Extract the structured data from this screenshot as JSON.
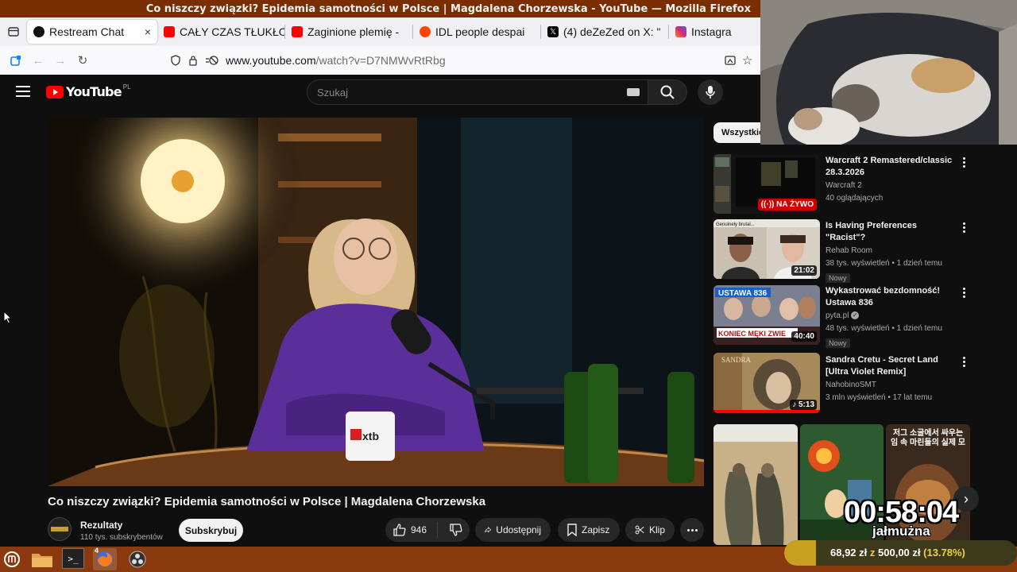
{
  "window": {
    "title": "Co niszczy związki? Epidemia samotności w Polsce | Magdalena Chorzewska - YouTube — Mozilla Firefox"
  },
  "tabs": [
    {
      "label": "Restream Chat",
      "close": "×",
      "favicon_color": "#111111",
      "icon": "restream-icon"
    },
    {
      "label": "CAŁY CZAS TŁUKŁO",
      "favicon_color": "#ff0000",
      "icon": "youtube-icon"
    },
    {
      "label": "Zaginione plemię -",
      "favicon_color": "#ff0000",
      "icon": "youtube-icon"
    },
    {
      "label": "IDL people despai",
      "favicon_color": "#ff4500",
      "icon": "reddit-icon"
    },
    {
      "label": "(4) deZeZed on X: \"",
      "favicon_color": "#000000",
      "icon": "x-icon"
    },
    {
      "label": "Instagra",
      "favicon_color": "#d62976",
      "icon": "instagram-icon"
    }
  ],
  "navbar": {
    "url_host": "www.youtube.com",
    "url_path": "/watch?v=D7NMWvRtRbg"
  },
  "youtube": {
    "logo_text": "YouTube",
    "region": "PL",
    "search_placeholder": "Szukaj",
    "brand_color": "#ff0000"
  },
  "video": {
    "title": "Co niszczy związki? Epidemia samotności w Polsce | Magdalena Chorzewska",
    "mug_text": "xtb",
    "channel": "Rezultaty",
    "subscribers": "110 tys. subskrybentów",
    "subscribe_label": "Subskrybuj",
    "likes": "946",
    "share_label": "Udostępnij",
    "save_label": "Zapisz",
    "clip_label": "Klip"
  },
  "sidebar": {
    "chip": "Wszystkie",
    "recommendations": [
      {
        "title": "Warcraft 2 Remastered/classic 28.3.2026",
        "channel": "Warcraft 2",
        "stats": "40 oglądających",
        "live_label": "NA ŻYWO"
      },
      {
        "title": "Is Having Preferences \"Racist\"?",
        "channel": "Rehab Room",
        "stats": "38 tys. wyświetleń • 1 dzień temu",
        "badge": "Nowy",
        "duration": "21:02",
        "thumb_caption": "Genuinely brutal..."
      },
      {
        "title": "Wykastrować bezdomność! Ustawa 836",
        "channel": "pyta.pl",
        "stats": "48 tys. wyświetleń • 1 dzień temu",
        "badge": "Nowy",
        "duration": "40:40",
        "thumb_top": "USTAWA 836",
        "thumb_bottom": "KONIEC MĘKI ZWIE"
      },
      {
        "title": "Sandra Cretu - Secret Land [Ultra Violet Remix]",
        "channel": "NahobinoSMT",
        "stats": "3 mln wyświetleń • 17 lat temu",
        "duration": "5:13",
        "thumb_top": "SANDRA"
      }
    ],
    "shorts_caption": "저그 소굴에서 싸우는 임 속 마린들의 실제 모"
  },
  "overlay": {
    "timer": "00:58:04",
    "timer_label": "jałmużna",
    "donation_current": "68,92 zł",
    "donation_sep": "z",
    "donation_target": "500,00 zł",
    "donation_percent": "(13.78%)",
    "donation_fraction": 0.1378
  },
  "taskbar": {
    "firefox_badge": "4"
  }
}
